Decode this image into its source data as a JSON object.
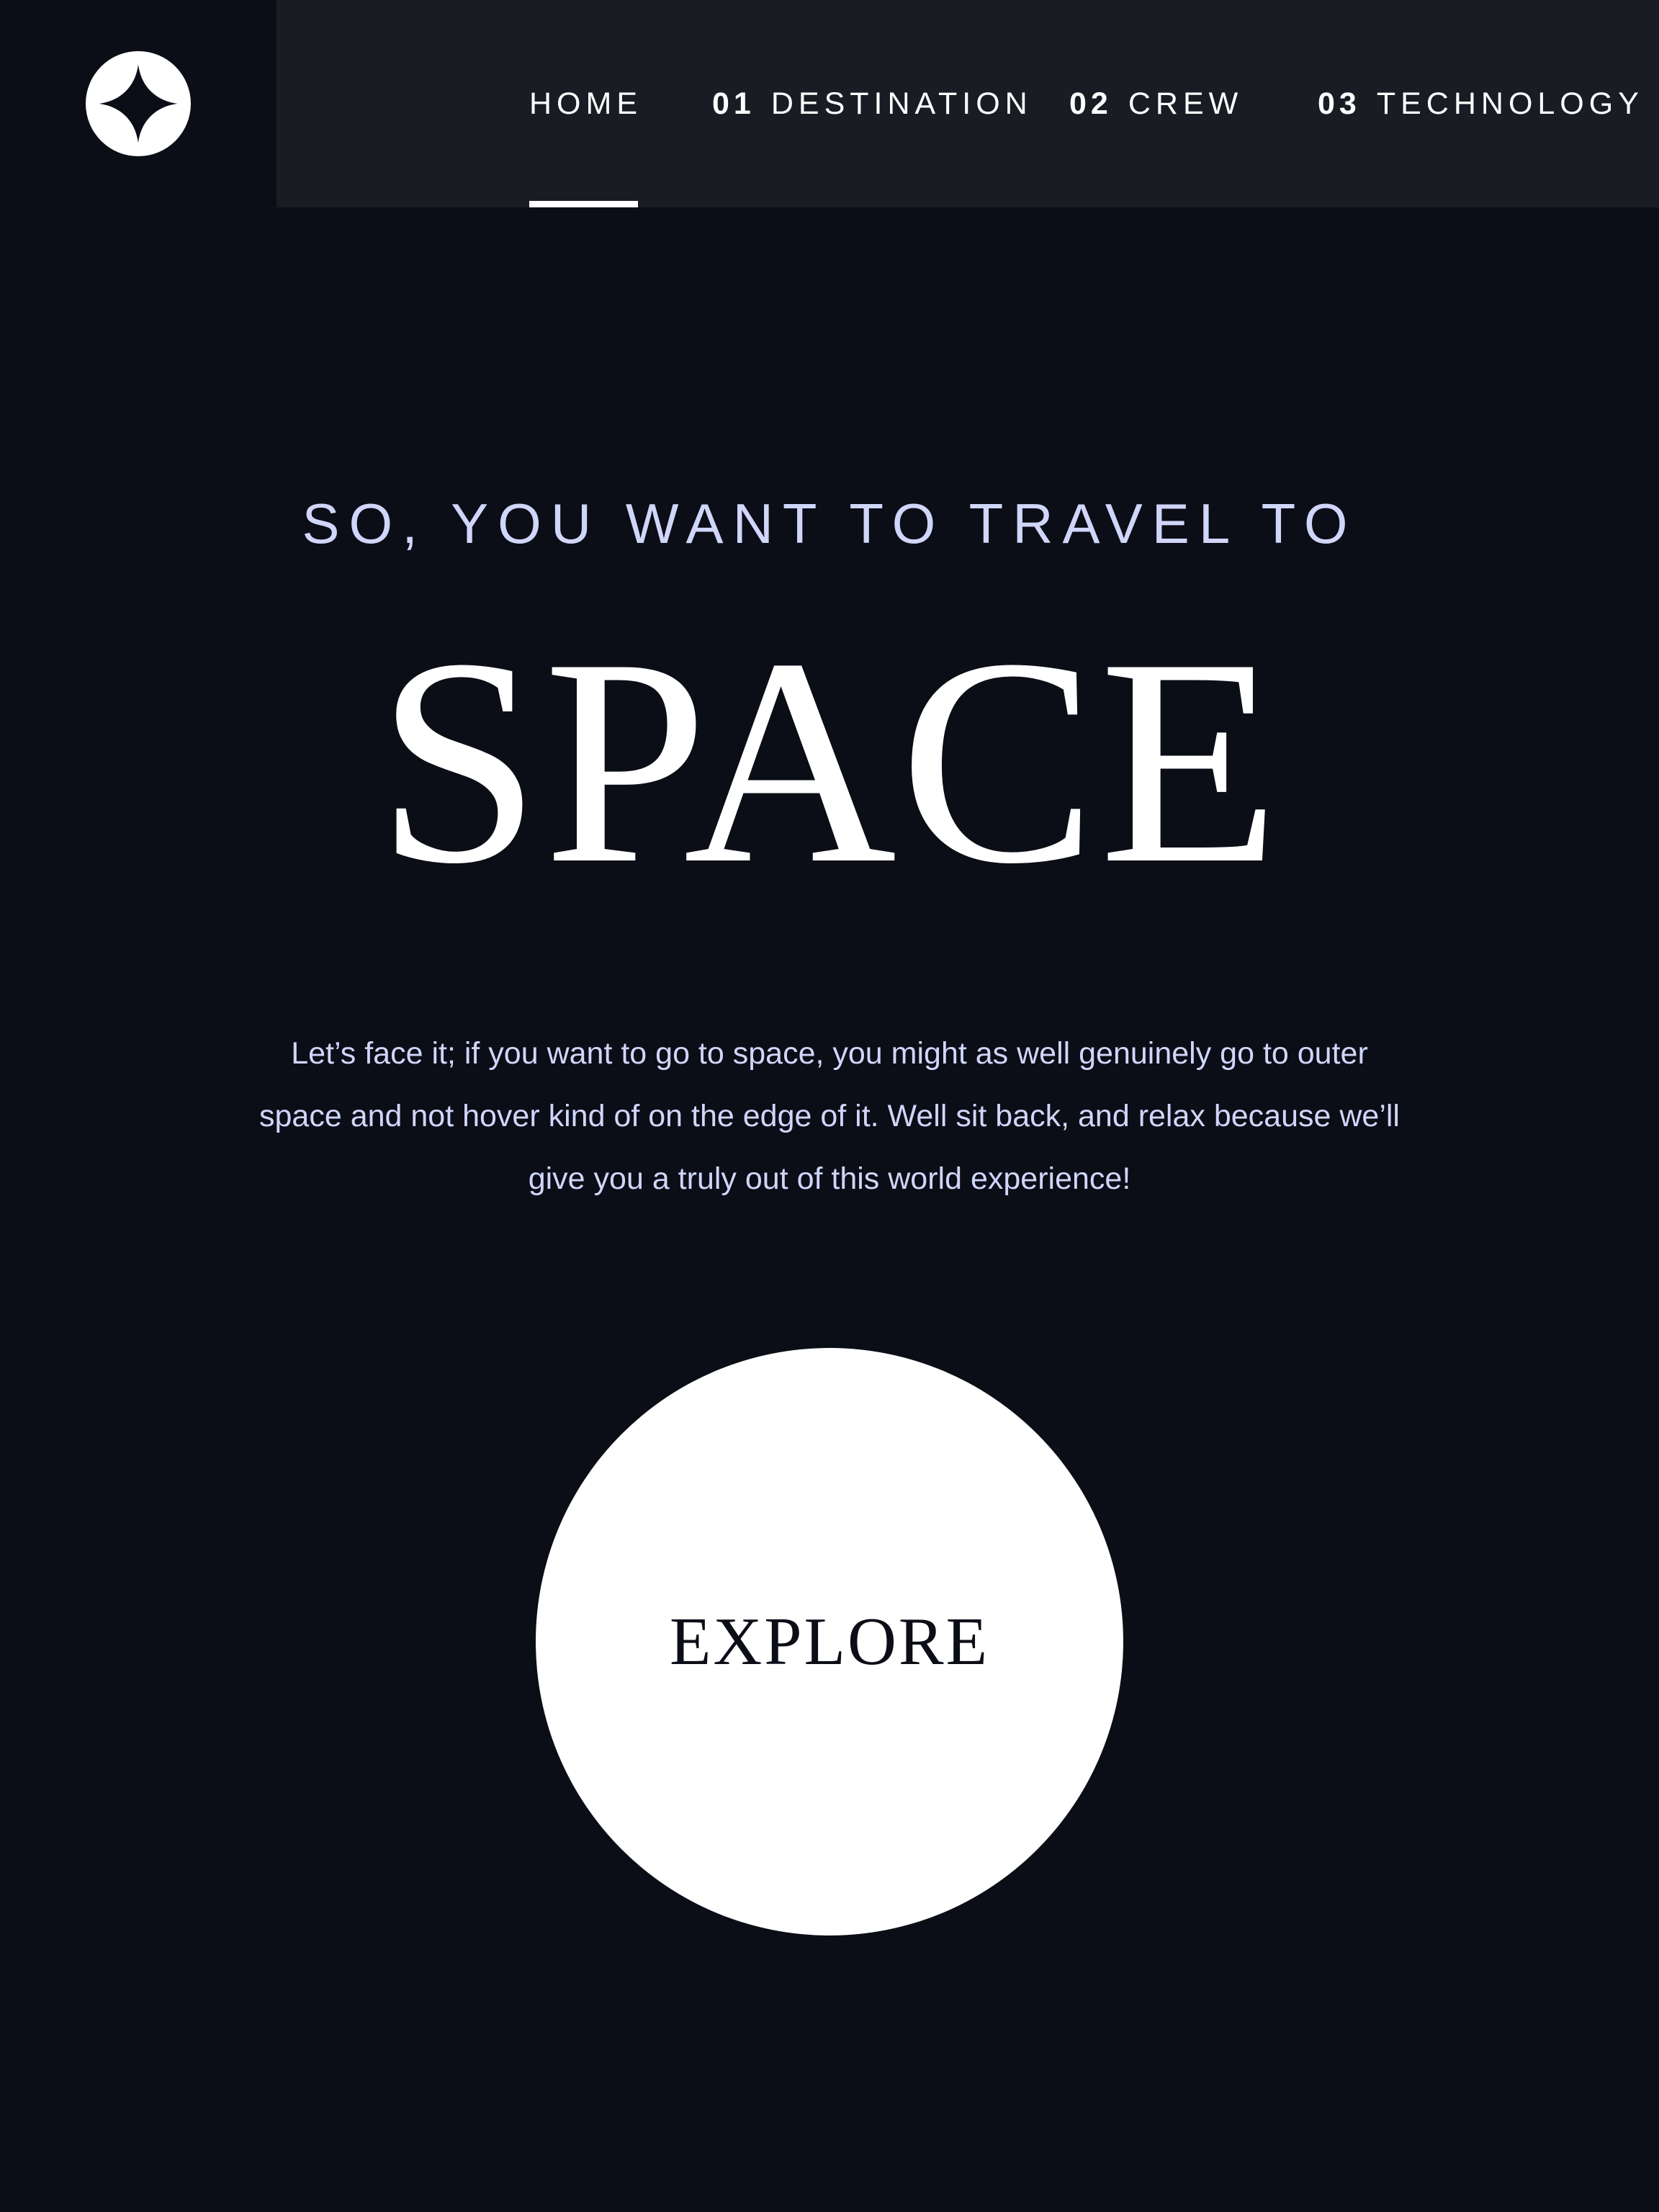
{
  "header": {
    "logo_icon": "star-logo-icon"
  },
  "nav": {
    "items": [
      {
        "number": "",
        "label": "HOME",
        "active": true
      },
      {
        "number": "01",
        "label": "DESTINATION",
        "active": false
      },
      {
        "number": "02",
        "label": "CREW",
        "active": false
      },
      {
        "number": "03",
        "label": "TECHNOLOGY",
        "active": false
      }
    ]
  },
  "hero": {
    "eyebrow": "SO, YOU WANT TO TRAVEL TO",
    "title": "SPACE",
    "body": "Let’s face it; if you want to go to space, you might as well genuinely go to outer space and not hover kind of on the edge of it. Well sit back, and relax because we’ll give you a truly out of this world experience!",
    "cta_label": "EXPLORE"
  },
  "colors": {
    "background": "#0b0d17",
    "nav_background": "#1a1c24",
    "accent_text": "#d0d6f9",
    "white": "#ffffff"
  }
}
